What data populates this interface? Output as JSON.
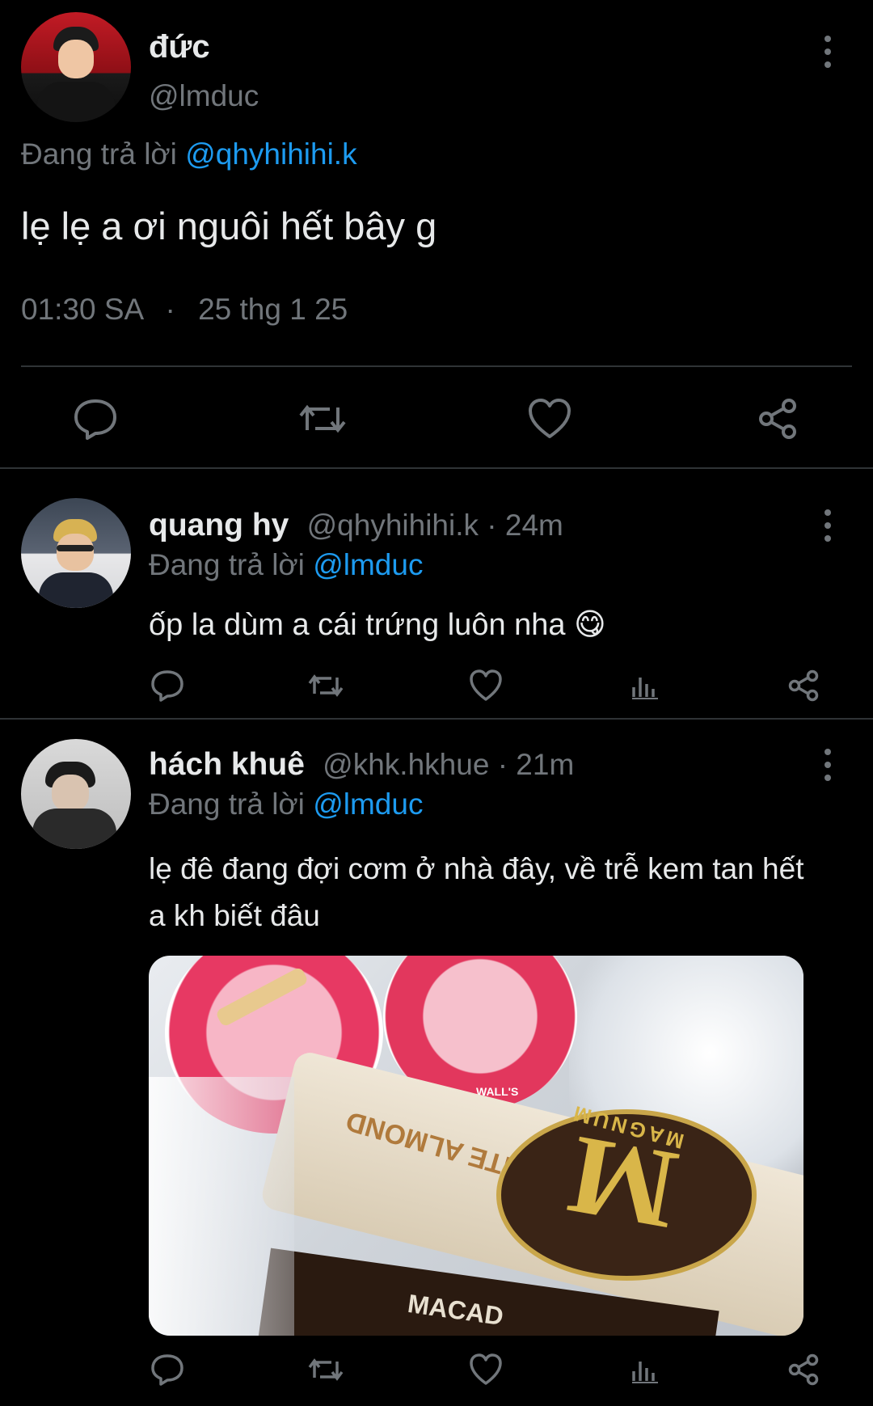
{
  "main_tweet": {
    "display_name": "đức",
    "handle": "@lmduc",
    "replying_prefix": "Đang trả lời",
    "replying_to": "@qhyhihihi.k",
    "text": "lẹ lẹ a ơi nguôi hết bây g",
    "time": "01:30 SA",
    "dot": "·",
    "date": "25 thg 1 25"
  },
  "replies": [
    {
      "display_name": "quang hy",
      "handle": "@qhyhihihi.k",
      "age": "· 24m",
      "replying_prefix": "Đang trả lời",
      "replying_to": "@lmduc",
      "text": "ốp la dùm a cái trứng luôn nha",
      "emoji": "😋"
    },
    {
      "display_name": "hách khuê",
      "handle": "@khk.hkhue",
      "age": "· 21m",
      "replying_prefix": "Đang trả lời",
      "replying_to": "@lmduc",
      "text_line1": "lẹ đê đang đợi cơm ở nhà đây, về trễ kem tan hết",
      "text_line2": "a kh biết đâu",
      "photo_text": {
        "brand_left": "WALL'S",
        "brand_right": "MAGNUM",
        "wrapper_text": "WHITE ALMOND",
        "bottom_text": "MACAD"
      }
    }
  ],
  "colors": {
    "background": "#000000",
    "text": "#e7e9ea",
    "muted": "#71767b",
    "link": "#1d9bf0",
    "divider": "#2f3336"
  },
  "icons": [
    "reply-icon",
    "retweet-icon",
    "like-icon",
    "share-icon",
    "views-icon",
    "more-icon"
  ]
}
